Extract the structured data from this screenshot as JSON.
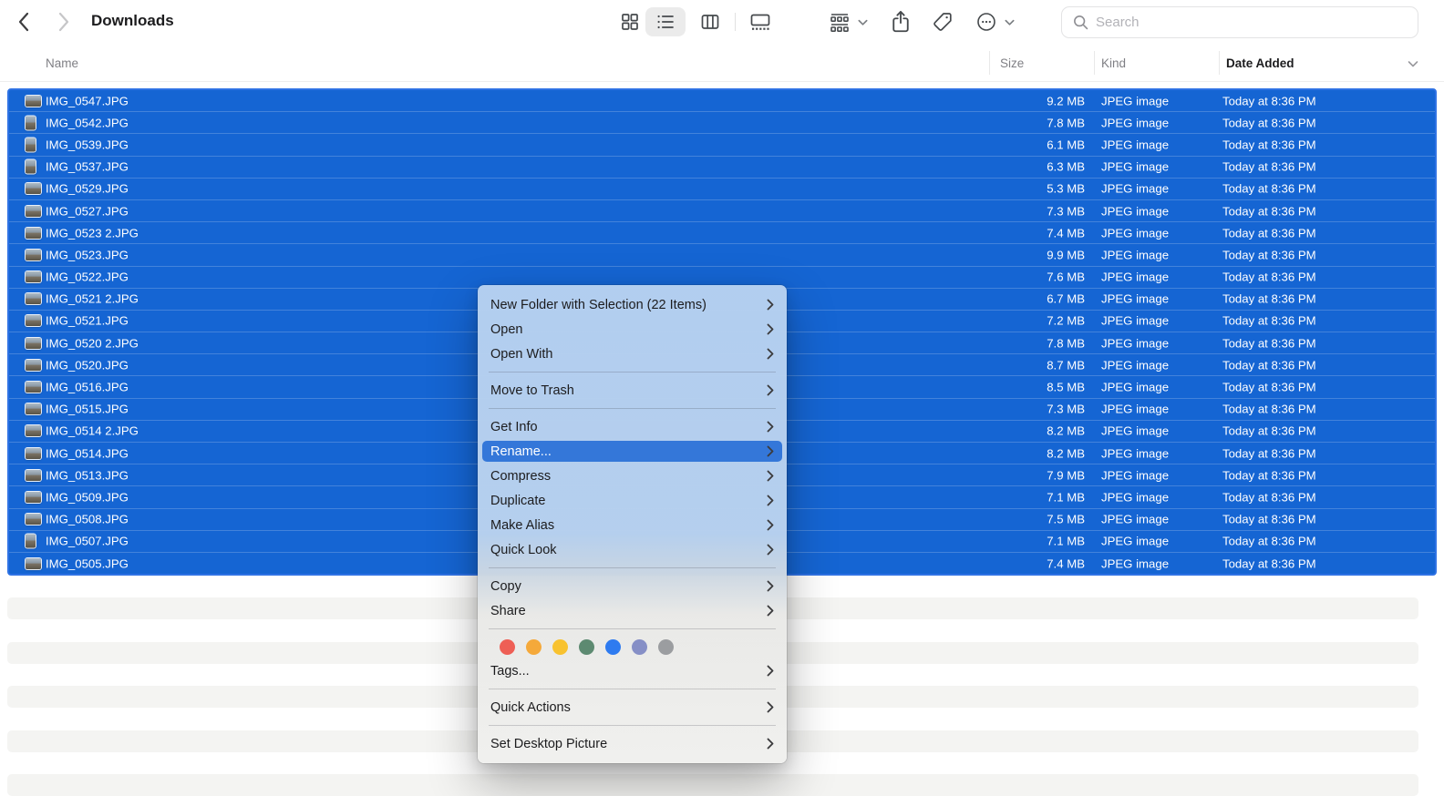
{
  "toolbar": {
    "back_icon": "chevron-left",
    "forward_icon": "chevron-right",
    "title": "Downloads",
    "view_modes": [
      "icon-view",
      "list-view",
      "column-view",
      "gallery-view"
    ],
    "active_view": "list-view",
    "actions": [
      "group-by",
      "share",
      "tags",
      "more-options"
    ],
    "search": {
      "placeholder": "Search",
      "icon": "magnifier-icon"
    }
  },
  "columns": {
    "name": "Name",
    "size": "Size",
    "kind": "Kind",
    "date_added": "Date Added",
    "sorted_by": "Date Added"
  },
  "selection": {
    "count": 22,
    "highlight_color": "#1565d3",
    "menu_highlight_color": "#3477d9"
  },
  "files": [
    {
      "name": "IMG_0547.JPG",
      "size": "9.2 MB",
      "kind": "JPEG image",
      "date_added": "Today at 8:36 PM",
      "thumb": "landscape"
    },
    {
      "name": "IMG_0542.JPG",
      "size": "7.8 MB",
      "kind": "JPEG image",
      "date_added": "Today at 8:36 PM",
      "thumb": "portrait"
    },
    {
      "name": "IMG_0539.JPG",
      "size": "6.1 MB",
      "kind": "JPEG image",
      "date_added": "Today at 8:36 PM",
      "thumb": "portrait"
    },
    {
      "name": "IMG_0537.JPG",
      "size": "6.3 MB",
      "kind": "JPEG image",
      "date_added": "Today at 8:36 PM",
      "thumb": "portrait"
    },
    {
      "name": "IMG_0529.JPG",
      "size": "5.3 MB",
      "kind": "JPEG image",
      "date_added": "Today at 8:36 PM",
      "thumb": "landscape"
    },
    {
      "name": "IMG_0527.JPG",
      "size": "7.3 MB",
      "kind": "JPEG image",
      "date_added": "Today at 8:36 PM",
      "thumb": "landscape"
    },
    {
      "name": "IMG_0523 2.JPG",
      "size": "7.4 MB",
      "kind": "JPEG image",
      "date_added": "Today at 8:36 PM",
      "thumb": "landscape"
    },
    {
      "name": "IMG_0523.JPG",
      "size": "9.9 MB",
      "kind": "JPEG image",
      "date_added": "Today at 8:36 PM",
      "thumb": "landscape"
    },
    {
      "name": "IMG_0522.JPG",
      "size": "7.6 MB",
      "kind": "JPEG image",
      "date_added": "Today at 8:36 PM",
      "thumb": "landscape"
    },
    {
      "name": "IMG_0521 2.JPG",
      "size": "6.7 MB",
      "kind": "JPEG image",
      "date_added": "Today at 8:36 PM",
      "thumb": "landscape"
    },
    {
      "name": "IMG_0521.JPG",
      "size": "7.2 MB",
      "kind": "JPEG image",
      "date_added": "Today at 8:36 PM",
      "thumb": "landscape"
    },
    {
      "name": "IMG_0520 2.JPG",
      "size": "7.8 MB",
      "kind": "JPEG image",
      "date_added": "Today at 8:36 PM",
      "thumb": "landscape"
    },
    {
      "name": "IMG_0520.JPG",
      "size": "8.7 MB",
      "kind": "JPEG image",
      "date_added": "Today at 8:36 PM",
      "thumb": "landscape"
    },
    {
      "name": "IMG_0516.JPG",
      "size": "8.5 MB",
      "kind": "JPEG image",
      "date_added": "Today at 8:36 PM",
      "thumb": "landscape"
    },
    {
      "name": "IMG_0515.JPG",
      "size": "7.3 MB",
      "kind": "JPEG image",
      "date_added": "Today at 8:36 PM",
      "thumb": "landscape"
    },
    {
      "name": "IMG_0514 2.JPG",
      "size": "8.2 MB",
      "kind": "JPEG image",
      "date_added": "Today at 8:36 PM",
      "thumb": "landscape"
    },
    {
      "name": "IMG_0514.JPG",
      "size": "8.2 MB",
      "kind": "JPEG image",
      "date_added": "Today at 8:36 PM",
      "thumb": "landscape"
    },
    {
      "name": "IMG_0513.JPG",
      "size": "7.9 MB",
      "kind": "JPEG image",
      "date_added": "Today at 8:36 PM",
      "thumb": "landscape"
    },
    {
      "name": "IMG_0509.JPG",
      "size": "7.1 MB",
      "kind": "JPEG image",
      "date_added": "Today at 8:36 PM",
      "thumb": "landscape"
    },
    {
      "name": "IMG_0508.JPG",
      "size": "7.5 MB",
      "kind": "JPEG image",
      "date_added": "Today at 8:36 PM",
      "thumb": "landscape"
    },
    {
      "name": "IMG_0507.JPG",
      "size": "7.1 MB",
      "kind": "JPEG image",
      "date_added": "Today at 8:36 PM",
      "thumb": "portrait"
    },
    {
      "name": "IMG_0505.JPG",
      "size": "7.4 MB",
      "kind": "JPEG image",
      "date_added": "Today at 8:36 PM",
      "thumb": "landscape"
    }
  ],
  "context_menu": {
    "items": [
      {
        "type": "item",
        "label": "New Folder with Selection (22 Items)"
      },
      {
        "type": "item",
        "label": "Open"
      },
      {
        "type": "item",
        "label": "Open With",
        "submenu": true
      },
      {
        "type": "separator"
      },
      {
        "type": "item",
        "label": "Move to Trash"
      },
      {
        "type": "separator"
      },
      {
        "type": "item",
        "label": "Get Info"
      },
      {
        "type": "item",
        "label": "Rename...",
        "highlighted": true
      },
      {
        "type": "item",
        "label": "Compress"
      },
      {
        "type": "item",
        "label": "Duplicate"
      },
      {
        "type": "item",
        "label": "Make Alias"
      },
      {
        "type": "item",
        "label": "Quick Look"
      },
      {
        "type": "separator"
      },
      {
        "type": "item",
        "label": "Copy"
      },
      {
        "type": "item",
        "label": "Share",
        "submenu": true
      },
      {
        "type": "separator"
      },
      {
        "type": "tags"
      },
      {
        "type": "item",
        "label": "Tags..."
      },
      {
        "type": "separator"
      },
      {
        "type": "item",
        "label": "Quick Actions",
        "submenu": true
      },
      {
        "type": "separator"
      },
      {
        "type": "item",
        "label": "Set Desktop Picture"
      }
    ],
    "tag_colors": [
      "#ee5f55",
      "#f5a93a",
      "#f8c22f",
      "#5d8a71",
      "#2e7bf0",
      "#868fc6",
      "#9b9da0"
    ]
  }
}
